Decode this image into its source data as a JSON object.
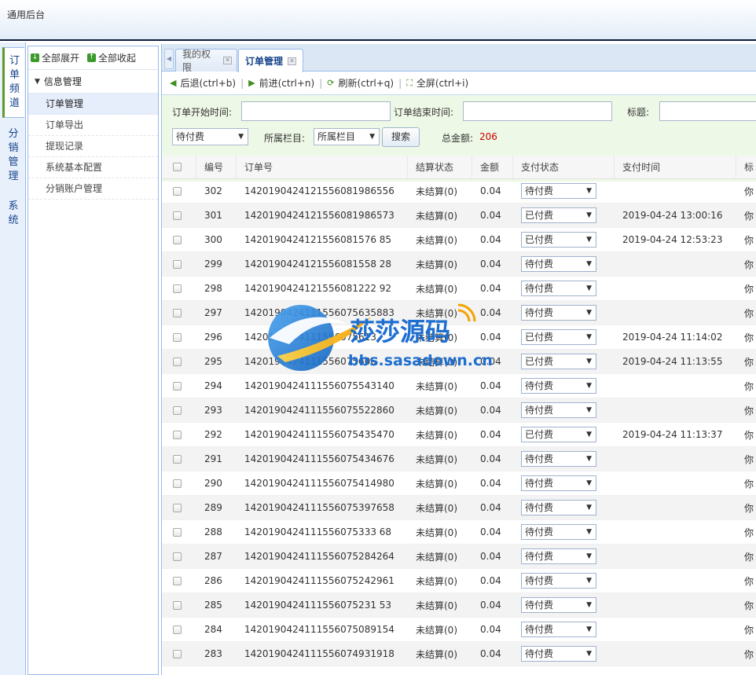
{
  "app": {
    "title": "通用后台"
  },
  "vtabs": [
    {
      "label": "订单频道",
      "active": true
    },
    {
      "label": "分销管理",
      "active": false
    },
    {
      "label": "系统",
      "active": false
    }
  ],
  "sidebar": {
    "expand_all": "全部展开",
    "collapse_all": "全部收起",
    "group": "信息管理",
    "items": [
      "订单管理",
      "订单导出",
      "提现记录",
      "系统基本配置",
      "分销账户管理"
    ],
    "active_index": 0
  },
  "tabs": [
    {
      "label": "我的权限",
      "active": false
    },
    {
      "label": "订单管理",
      "active": true
    }
  ],
  "toolbar": {
    "back": "后退(ctrl+b)",
    "forward": "前进(ctrl+n)",
    "refresh": "刷新(ctrl+q)",
    "fullscreen": "全屏(ctrl+i)"
  },
  "filters": {
    "start_label": "订单开始时间:",
    "end_label": "订单结束时间:",
    "title_label": "标题:",
    "start_value": "",
    "end_value": "",
    "title_value": "",
    "status_selected": "待付费",
    "column_label": "所属栏目:",
    "column_selected": "所属栏目",
    "search_button": "搜索",
    "total_label": "总金额:",
    "total_value": "206"
  },
  "table": {
    "columns": [
      "编号",
      "订单号",
      "结算状态",
      "金额",
      "支付状态",
      "支付时间",
      "标"
    ],
    "rows": [
      {
        "id": "302",
        "order_no": "1420190424121556081986556",
        "settle": "未结算(0)",
        "amount": "0.04",
        "pay_status": "待付费",
        "pay_time": "",
        "title": "你"
      },
      {
        "id": "301",
        "order_no": "1420190424121556081986573",
        "settle": "未结算(0)",
        "amount": "0.04",
        "pay_status": "已付费",
        "pay_time": "2019-04-24 13:00:16",
        "title": "你"
      },
      {
        "id": "300",
        "order_no": "1420190424121556081576 85",
        "settle": "未结算(0)",
        "amount": "0.04",
        "pay_status": "已付费",
        "pay_time": "2019-04-24 12:53:23",
        "title": "你"
      },
      {
        "id": "299",
        "order_no": "1420190424121556081558 28",
        "settle": "未结算(0)",
        "amount": "0.04",
        "pay_status": "待付费",
        "pay_time": "",
        "title": "你"
      },
      {
        "id": "298",
        "order_no": "1420190424121556081222 92",
        "settle": "未结算(0)",
        "amount": "0.04",
        "pay_status": "待付费",
        "pay_time": "",
        "title": "你"
      },
      {
        "id": "297",
        "order_no": "1420190424111556075635883",
        "settle": "未结算(0)",
        "amount": "0.04",
        "pay_status": "待付费",
        "pay_time": "",
        "title": "你"
      },
      {
        "id": "296",
        "order_no": "1420190424111556075613",
        "settle": "未结算(0)",
        "amount": "0.04",
        "pay_status": "已付费",
        "pay_time": "2019-04-24 11:14:02",
        "title": "你"
      },
      {
        "id": "295",
        "order_no": "1420190424111556075606",
        "settle": "未结算(0)",
        "amount": "0.04",
        "pay_status": "已付费",
        "pay_time": "2019-04-24 11:13:55",
        "title": "你"
      },
      {
        "id": "294",
        "order_no": "1420190424111556075543140",
        "settle": "未结算(0)",
        "amount": "0.04",
        "pay_status": "待付费",
        "pay_time": "",
        "title": "你"
      },
      {
        "id": "293",
        "order_no": "1420190424111556075522860",
        "settle": "未结算(0)",
        "amount": "0.04",
        "pay_status": "待付费",
        "pay_time": "",
        "title": "你"
      },
      {
        "id": "292",
        "order_no": "1420190424111556075435470",
        "settle": "未结算(0)",
        "amount": "0.04",
        "pay_status": "已付费",
        "pay_time": "2019-04-24 11:13:37",
        "title": "你"
      },
      {
        "id": "291",
        "order_no": "1420190424111556075434676",
        "settle": "未结算(0)",
        "amount": "0.04",
        "pay_status": "待付费",
        "pay_time": "",
        "title": "你"
      },
      {
        "id": "290",
        "order_no": "1420190424111556075414980",
        "settle": "未结算(0)",
        "amount": "0.04",
        "pay_status": "待付费",
        "pay_time": "",
        "title": "你"
      },
      {
        "id": "289",
        "order_no": "1420190424111556075397658",
        "settle": "未结算(0)",
        "amount": "0.04",
        "pay_status": "待付费",
        "pay_time": "",
        "title": "你"
      },
      {
        "id": "288",
        "order_no": "1420190424111556075333 68",
        "settle": "未结算(0)",
        "amount": "0.04",
        "pay_status": "待付费",
        "pay_time": "",
        "title": "你"
      },
      {
        "id": "287",
        "order_no": "1420190424111556075284264",
        "settle": "未结算(0)",
        "amount": "0.04",
        "pay_status": "待付费",
        "pay_time": "",
        "title": "你"
      },
      {
        "id": "286",
        "order_no": "1420190424111556075242961",
        "settle": "未结算(0)",
        "amount": "0.04",
        "pay_status": "待付费",
        "pay_time": "",
        "title": "你"
      },
      {
        "id": "285",
        "order_no": "1420190424111556075231 53",
        "settle": "未结算(0)",
        "amount": "0.04",
        "pay_status": "待付费",
        "pay_time": "",
        "title": "你"
      },
      {
        "id": "284",
        "order_no": "1420190424111556075089154",
        "settle": "未结算(0)",
        "amount": "0.04",
        "pay_status": "待付费",
        "pay_time": "",
        "title": "你"
      },
      {
        "id": "283",
        "order_no": "1420190424111556074931918",
        "settle": "未结算(0)",
        "amount": "0.04",
        "pay_status": "待付费",
        "pay_time": "",
        "title": "你"
      }
    ]
  },
  "watermark": {
    "cn": "莎莎源码",
    "url": "bbs.sasadown.cn"
  },
  "icons": {
    "expand": "expand-all-icon",
    "collapse": "collapse-all-icon",
    "back": "back-arrow-icon",
    "forward": "forward-arrow-icon",
    "refresh": "refresh-icon",
    "fullscreen": "fullscreen-icon"
  }
}
